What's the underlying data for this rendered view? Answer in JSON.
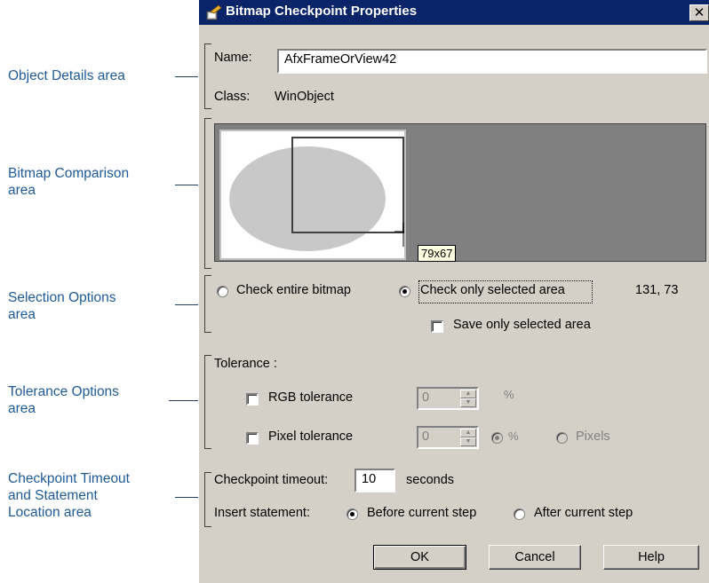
{
  "annotations": [
    {
      "name": "object-details",
      "text": "Object Details area"
    },
    {
      "name": "bitmap-comparison",
      "text": "Bitmap Comparison\narea"
    },
    {
      "name": "selection-options",
      "text": "Selection Options\narea"
    },
    {
      "name": "tolerance-options",
      "text": "Tolerance Options\narea"
    },
    {
      "name": "checkpoint-timeout",
      "text": "Checkpoint Timeout\nand Statement\nLocation area"
    }
  ],
  "dialog": {
    "title": "Bitmap Checkpoint Properties",
    "close_glyph": "✕",
    "name_label": "Name:",
    "name_value": "AfxFrameOrView42",
    "class_label": "Class:",
    "class_value": "WinObject"
  },
  "preview": {
    "size_tooltip": "79x67"
  },
  "selection": {
    "entire_label": "Check entire bitmap",
    "selected_label": "Check only selected area",
    "coords": "131, 73",
    "save_selected_label": "Save only selected area"
  },
  "tolerance": {
    "heading": "Tolerance :",
    "rgb_label": "RGB tolerance",
    "rgb_value": "0",
    "rgb_unit": "%",
    "pixel_label": "Pixel tolerance",
    "pixel_value": "0",
    "percent_label": "%",
    "pixels_label": "Pixels"
  },
  "timeout": {
    "label": "Checkpoint timeout:",
    "value": "10",
    "unit": "seconds",
    "insert_label": "Insert statement:",
    "before_label": "Before current step",
    "after_label": "After current step"
  },
  "buttons": {
    "ok": "OK",
    "cancel": "Cancel",
    "help": "Help"
  },
  "colors": {
    "title_bar": "#0a246a",
    "annotation_text": "#1f5a96",
    "dialog_face": "#d4d0c8"
  }
}
